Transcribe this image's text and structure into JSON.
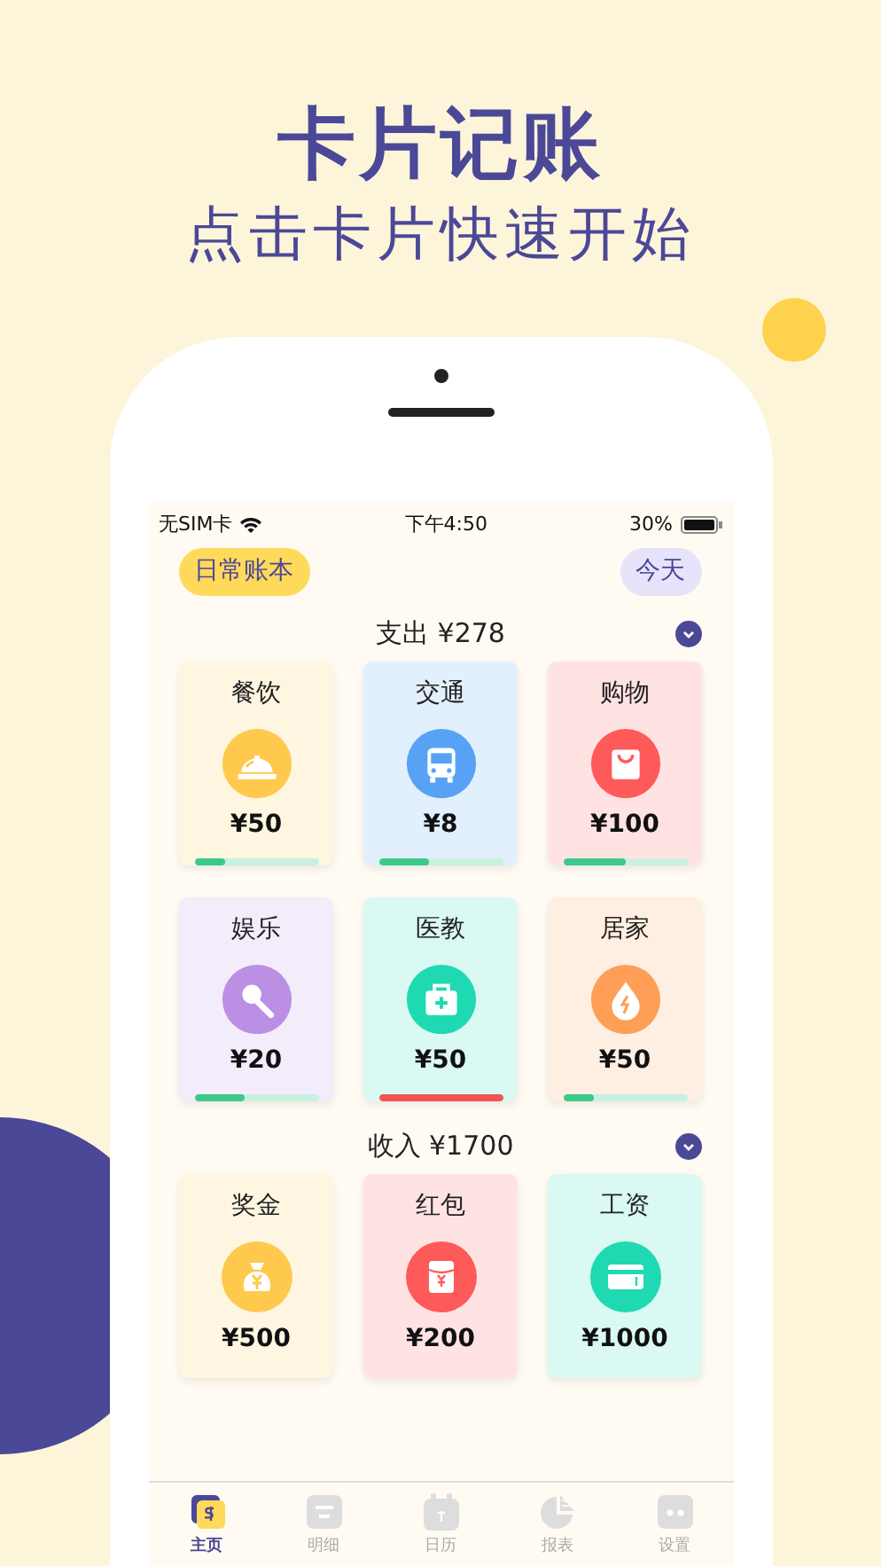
{
  "headline": {
    "title": "卡片记账",
    "subtitle": "点击卡片快速开始"
  },
  "status_bar": {
    "carrier": "无SIM卡",
    "time": "下午4:50",
    "battery": "30%"
  },
  "book_button": "日常账本",
  "today_button": "今天",
  "sections": [
    {
      "title": "支出 ¥278",
      "expanded": true,
      "cards": [
        {
          "kind": "dining",
          "name": "餐饮",
          "amount": "¥50",
          "color": "#ffc94d",
          "level": 0.25,
          "over_budget": false
        },
        {
          "kind": "bus",
          "name": "交通",
          "amount": "¥8",
          "color": "#57a2f5",
          "level": 0.4,
          "over_budget": false
        },
        {
          "kind": "shopping",
          "name": "购物",
          "amount": "¥100",
          "color": "#ff5a5a",
          "level": 0.5,
          "over_budget": false
        },
        {
          "kind": "karaoke",
          "name": "娱乐",
          "amount": "¥20",
          "color": "#bb8fe3",
          "level": 0.4,
          "over_budget": false
        },
        {
          "kind": "medical",
          "name": "医教",
          "amount": "¥50",
          "color": "#1ed9b1",
          "level": 1,
          "over_budget": true
        },
        {
          "kind": "home",
          "name": "居家",
          "amount": "¥50",
          "color": "#ff9f57",
          "level": 0.25,
          "over_budget": false
        }
      ]
    },
    {
      "title": "收入 ¥1700",
      "expanded": true,
      "cards": [
        {
          "kind": "bonus",
          "name": "奖金",
          "amount": "¥500",
          "color": "#ffc94d"
        },
        {
          "kind": "redpacket",
          "name": "红包",
          "amount": "¥200",
          "color": "#ff5a5a"
        },
        {
          "kind": "salary",
          "name": "工资",
          "amount": "¥1000",
          "color": "#1ed9b1"
        }
      ]
    }
  ],
  "tabs": [
    {
      "kind": "home",
      "label": "主页",
      "selected": true
    },
    {
      "kind": "list",
      "label": "明细",
      "selected": false
    },
    {
      "kind": "calendar",
      "label": "日历",
      "selected": false
    },
    {
      "kind": "chart",
      "label": "报表",
      "selected": false
    },
    {
      "kind": "settings",
      "label": "设置",
      "selected": false
    }
  ]
}
